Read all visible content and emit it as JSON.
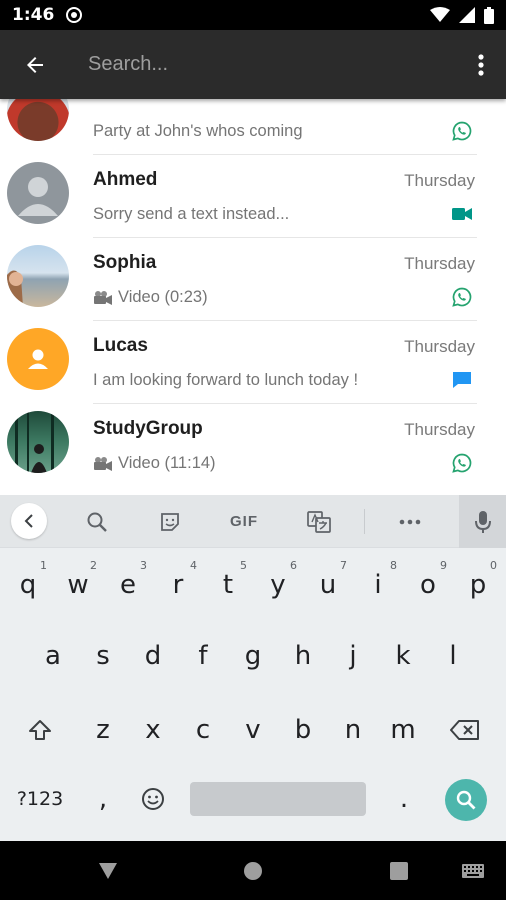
{
  "status_bar": {
    "time": "1:46"
  },
  "search": {
    "placeholder": "Search..."
  },
  "chats": [
    {
      "name": "",
      "time": "",
      "preview": "Party at John's whos coming",
      "status_icon": "whatsapp-icon"
    },
    {
      "name": "Ahmed",
      "time": "Thursday",
      "preview": "Sorry send a text instead...",
      "status_icon": "video-camera-icon"
    },
    {
      "name": "Sophia",
      "time": "Thursday",
      "preview": "Video (0:23)",
      "preview_icon": "video-camera-emoji-icon",
      "status_icon": "whatsapp-icon"
    },
    {
      "name": "Lucas",
      "time": "Thursday",
      "preview": "I am looking forward to lunch today !",
      "status_icon": "message-bubble-icon"
    },
    {
      "name": "StudyGroup",
      "time": "Thursday",
      "preview": "Video (11:14)",
      "preview_icon": "video-camera-emoji-icon",
      "status_icon": "whatsapp-icon"
    }
  ],
  "colors": {
    "app_bar": "#2b2b2b",
    "accent_green": "#25d366",
    "teal": "#009688",
    "blue": "#2196f3",
    "search_key": "#4db6ac"
  },
  "keyboard": {
    "toolbar": {
      "gif_label": "GIF"
    },
    "row1": [
      "q",
      "w",
      "e",
      "r",
      "t",
      "y",
      "u",
      "i",
      "o",
      "p"
    ],
    "row1_hints": [
      "1",
      "2",
      "3",
      "4",
      "5",
      "6",
      "7",
      "8",
      "9",
      "0"
    ],
    "row2": [
      "a",
      "s",
      "d",
      "f",
      "g",
      "h",
      "j",
      "k",
      "l"
    ],
    "row3": [
      "z",
      "x",
      "c",
      "v",
      "b",
      "n",
      "m"
    ],
    "symbols_label": "?123",
    "comma": ",",
    "period": "."
  }
}
